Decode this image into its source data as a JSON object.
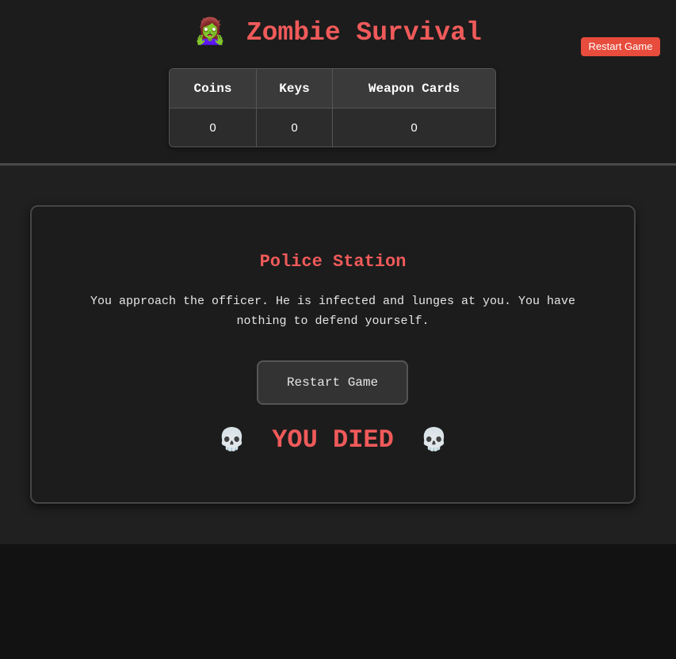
{
  "header": {
    "title": "Zombie Survival",
    "title_icon": "🧟‍♀️",
    "restart_label": "Restart Game",
    "restart_color": "#e74c3c"
  },
  "inventory": {
    "headers": [
      "Coins",
      "Keys",
      "Weapon Cards"
    ],
    "values": [
      "0",
      "0",
      "0"
    ]
  },
  "scene": {
    "location": "Police Station",
    "story": "You approach the officer. He is infected and lunges at you. You have nothing to defend yourself.",
    "restart_label": "Restart Game",
    "status_text": "YOU DIED",
    "status_icon": "💀"
  },
  "colors": {
    "accent": "#f05a5a",
    "background": "#121212",
    "panel": "#1c1c1c"
  }
}
